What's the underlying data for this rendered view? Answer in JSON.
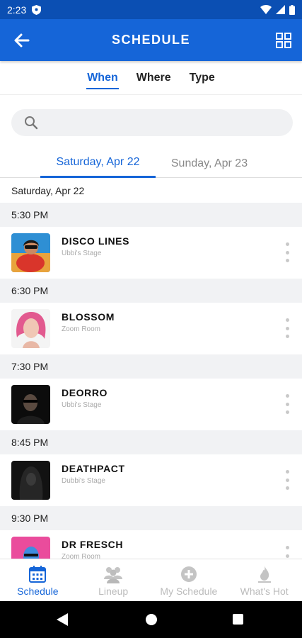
{
  "status_bar": {
    "time": "2:23"
  },
  "app_bar": {
    "title": "SCHEDULE"
  },
  "filter_tabs": [
    {
      "label": "When",
      "active": true
    },
    {
      "label": "Where",
      "active": false
    },
    {
      "label": "Type",
      "active": false
    }
  ],
  "search": {
    "placeholder": ""
  },
  "day_tabs": [
    {
      "label": "Saturday, Apr 22",
      "active": true
    },
    {
      "label": "Sunday, Apr 23",
      "active": false
    }
  ],
  "date_header": "Saturday, Apr 22",
  "schedule": [
    {
      "time": "5:30 PM",
      "name": "DISCO LINES",
      "stage": "Ubbi's Stage"
    },
    {
      "time": "6:30 PM",
      "name": "BLOSSOM",
      "stage": "Zoom Room"
    },
    {
      "time": "7:30 PM",
      "name": "DEORRO",
      "stage": "Ubbi's Stage"
    },
    {
      "time": "8:45 PM",
      "name": "DEATHPACT",
      "stage": "Dubbi's Stage"
    },
    {
      "time": "9:30 PM",
      "name": "DR FRESCH",
      "stage": "Zoom Room"
    }
  ],
  "bottom_nav": [
    {
      "label": "Schedule",
      "icon": "calendar-icon",
      "active": true
    },
    {
      "label": "Lineup",
      "icon": "people-icon",
      "active": false
    },
    {
      "label": "My Schedule",
      "icon": "plus-circle-icon",
      "active": false
    },
    {
      "label": "What's Hot",
      "icon": "flame-icon",
      "active": false
    }
  ],
  "colors": {
    "primary": "#1565d8",
    "status_bar": "#0b4fb3",
    "time_row_bg": "#f1f2f4"
  }
}
